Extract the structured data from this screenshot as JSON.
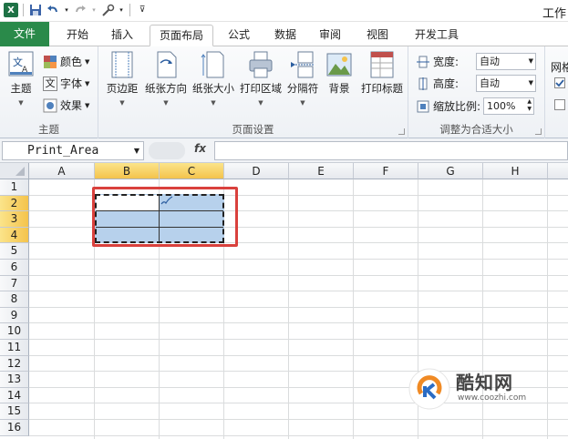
{
  "titlebar": {
    "title": "工作",
    "qat_icons": [
      "excel-icon",
      "save-icon",
      "undo-icon",
      "redo-icon",
      "customize-icon"
    ]
  },
  "tabs": [
    {
      "label": "文件",
      "type": "file"
    },
    {
      "label": "开始"
    },
    {
      "label": "插入"
    },
    {
      "label": "页面布局",
      "active": true
    },
    {
      "label": "公式"
    },
    {
      "label": "数据"
    },
    {
      "label": "审阅"
    },
    {
      "label": "视图"
    },
    {
      "label": "开发工具"
    }
  ],
  "ribbon": {
    "theme_group": {
      "label": "主题",
      "themes_button": "主题",
      "colors": "颜色",
      "fonts": "字体",
      "effects": "效果"
    },
    "page_setup_group": {
      "label": "页面设置",
      "margins": "页边距",
      "orientation": "纸张方向",
      "size": "纸张大小",
      "print_area": "打印区域",
      "breaks": "分隔符",
      "background": "背景",
      "print_titles": "打印标题"
    },
    "scale_group": {
      "label": "调整为合适大小",
      "width_label": "宽度:",
      "width_value": "自动",
      "height_label": "高度:",
      "height_value": "自动",
      "scale_label": "缩放比例:",
      "scale_value": "100%"
    },
    "sheet_options_group": {
      "label_partial": "网格"
    }
  },
  "formula_bar": {
    "name_box": "Print_Area",
    "fx": "fx",
    "formula": ""
  },
  "grid": {
    "columns": [
      "A",
      "B",
      "C",
      "D",
      "E",
      "F",
      "G",
      "H"
    ],
    "rows": [
      "1",
      "2",
      "3",
      "4",
      "5",
      "6",
      "7",
      "8",
      "9",
      "10",
      "11",
      "12",
      "13",
      "14",
      "15",
      "16"
    ],
    "selected_columns": [
      "B",
      "C"
    ],
    "selected_rows": [
      "2",
      "3",
      "4"
    ],
    "print_area_range": "B2:C4"
  },
  "watermark": {
    "text": "酷知网",
    "url": "www.coozhi.com"
  },
  "colors": {
    "file_tab": "#2a8a4a",
    "selection_fill": "#b7d1ec",
    "highlight_border": "#d9413d",
    "header_selected": "#f4c34c"
  }
}
